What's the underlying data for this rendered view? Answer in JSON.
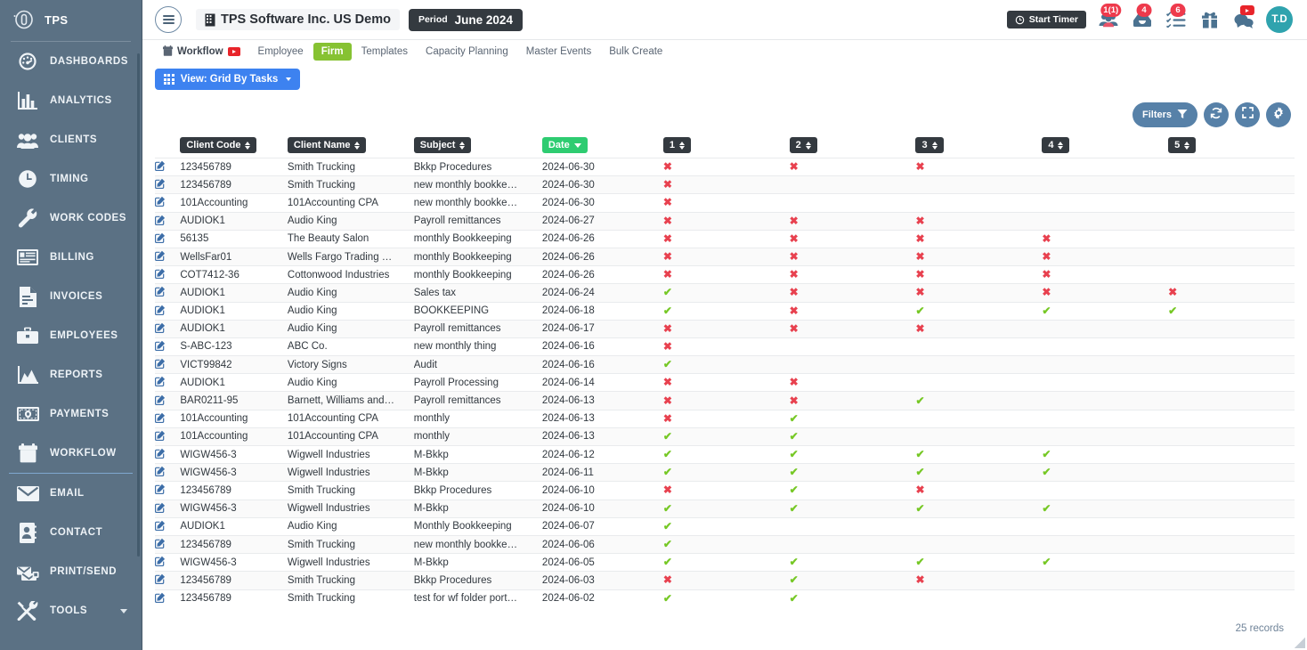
{
  "sidebar": {
    "brand": {
      "name": "TPS",
      "logo_icon": "tps-logo-icon"
    },
    "items": [
      {
        "label": "DASHBOARDS",
        "icon": "gauge-icon"
      },
      {
        "label": "ANALYTICS",
        "icon": "bar-chart-icon"
      },
      {
        "label": "CLIENTS",
        "icon": "people-icon"
      },
      {
        "label": "TIMING",
        "icon": "clock-icon"
      },
      {
        "label": "WORK CODES",
        "icon": "wrench-icon"
      },
      {
        "label": "BILLING",
        "icon": "billing-card-icon"
      },
      {
        "label": "INVOICES",
        "icon": "document-icon"
      },
      {
        "label": "EMPLOYEES",
        "icon": "briefcase-icon"
      },
      {
        "label": "REPORTS",
        "icon": "area-chart-icon"
      },
      {
        "label": "PAYMENTS",
        "icon": "banknote-icon"
      },
      {
        "label": "WORKFLOW",
        "icon": "calendar-icon"
      },
      {
        "label": "EMAIL",
        "icon": "envelope-icon"
      },
      {
        "label": "CONTACT",
        "icon": "address-book-icon"
      },
      {
        "label": "PRINT/SEND",
        "icon": "print-send-icon"
      },
      {
        "label": "TOOLS",
        "icon": "tools-icon",
        "caret": true
      }
    ]
  },
  "topbar": {
    "menu_icon": "hamburger-icon",
    "firm_icon": "building-icon",
    "firm_title": "TPS Software Inc. US Demo",
    "period_label": "Period",
    "period_value": "June 2024",
    "start_timer": "Start Timer",
    "icons": [
      {
        "name": "clients-group-icon",
        "badge": "1(1)"
      },
      {
        "name": "inbox-icon",
        "badge": "4"
      },
      {
        "name": "tasklist-icon",
        "badge": "6"
      },
      {
        "name": "gift-icon",
        "badge": ""
      },
      {
        "name": "chat-icon",
        "badge": "youtube"
      }
    ],
    "avatar": "T.D"
  },
  "subnav": {
    "tabs": [
      {
        "label": "Workflow",
        "active": false,
        "first": true,
        "youtube": true
      },
      {
        "label": "Employee",
        "active": false
      },
      {
        "label": "Firm",
        "active": true
      },
      {
        "label": "Templates",
        "active": false
      },
      {
        "label": "Capacity Planning",
        "active": false
      },
      {
        "label": "Master Events",
        "active": false
      },
      {
        "label": "Bulk Create",
        "active": false
      }
    ],
    "view_button": "View: Grid By Tasks"
  },
  "toolbar": {
    "filters_label": "Filters",
    "filter_icon": "funnel-icon",
    "refresh_icon": "refresh-icon",
    "expand_icon": "fullscreen-icon",
    "settings_icon": "gear-icon"
  },
  "table": {
    "columns": [
      {
        "key": "code",
        "label": "Client Code",
        "sort": "both"
      },
      {
        "key": "name",
        "label": "Client Name",
        "sort": "both"
      },
      {
        "key": "subject",
        "label": "Subject",
        "sort": "both"
      },
      {
        "key": "date",
        "label": "Date",
        "sort": "desc",
        "active": true
      },
      {
        "key": "s1",
        "label": "1",
        "sort": "both"
      },
      {
        "key": "s2",
        "label": "2",
        "sort": "both"
      },
      {
        "key": "s3",
        "label": "3",
        "sort": "both"
      },
      {
        "key": "s4",
        "label": "4",
        "sort": "both"
      },
      {
        "key": "s5",
        "label": "5",
        "sort": "both"
      }
    ],
    "edit_icon": "edit-pencil-icon",
    "mark_x": "✖",
    "mark_check": "✔",
    "colors": {
      "mark_x": "#e8414f",
      "mark_check": "#76c825",
      "accent_blue": "#3d82f0",
      "accent_green": "#86c232"
    },
    "rows": [
      {
        "code": "123456789",
        "name": "Smith Trucking",
        "subject": "Bkkp Procedures",
        "date": "2024-06-30",
        "marks": [
          "x",
          "x",
          "x",
          "",
          ""
        ]
      },
      {
        "code": "123456789",
        "name": "Smith Trucking",
        "subject": "new monthly bookke…",
        "date": "2024-06-30",
        "marks": [
          "x",
          "",
          "",
          "",
          ""
        ]
      },
      {
        "code": "101Accounting",
        "name": "101Accounting CPA",
        "subject": "new monthly bookke…",
        "date": "2024-06-30",
        "marks": [
          "x",
          "",
          "",
          "",
          ""
        ]
      },
      {
        "code": "AUDIOK1",
        "name": "Audio King",
        "subject": "Payroll remittances",
        "date": "2024-06-27",
        "marks": [
          "x",
          "x",
          "x",
          "",
          ""
        ]
      },
      {
        "code": "56135",
        "name": "The Beauty Salon",
        "subject": "monthly Bookkeeping",
        "date": "2024-06-26",
        "marks": [
          "x",
          "x",
          "x",
          "x",
          ""
        ]
      },
      {
        "code": "WellsFar01",
        "name": "Wells Fargo Trading …",
        "subject": "monthly Bookkeeping",
        "date": "2024-06-26",
        "marks": [
          "x",
          "x",
          "x",
          "x",
          ""
        ]
      },
      {
        "code": "COT7412-36",
        "name": "Cottonwood Industries",
        "subject": "monthly Bookkeeping",
        "date": "2024-06-26",
        "marks": [
          "x",
          "x",
          "x",
          "x",
          ""
        ]
      },
      {
        "code": "AUDIOK1",
        "name": "Audio King",
        "subject": "Sales tax",
        "date": "2024-06-24",
        "marks": [
          "v",
          "x",
          "x",
          "x",
          "x"
        ]
      },
      {
        "code": "AUDIOK1",
        "name": "Audio King",
        "subject": "BOOKKEEPING",
        "date": "2024-06-18",
        "marks": [
          "v",
          "x",
          "v",
          "v",
          "v"
        ]
      },
      {
        "code": "AUDIOK1",
        "name": "Audio King",
        "subject": "Payroll remittances",
        "date": "2024-06-17",
        "marks": [
          "x",
          "x",
          "x",
          "",
          ""
        ]
      },
      {
        "code": "S-ABC-123",
        "name": "ABC Co.",
        "subject": "new monthly thing",
        "date": "2024-06-16",
        "marks": [
          "x",
          "",
          "",
          "",
          ""
        ]
      },
      {
        "code": "VICT99842",
        "name": "Victory Signs",
        "subject": "Audit",
        "date": "2024-06-16",
        "marks": [
          "v",
          "",
          "",
          "",
          ""
        ]
      },
      {
        "code": "AUDIOK1",
        "name": "Audio King",
        "subject": "Payroll Processing",
        "date": "2024-06-14",
        "marks": [
          "x",
          "x",
          "",
          "",
          ""
        ]
      },
      {
        "code": "BAR0211-95",
        "name": "Barnett, Williams and…",
        "subject": "Payroll remittances",
        "date": "2024-06-13",
        "marks": [
          "x",
          "x",
          "v",
          "",
          ""
        ]
      },
      {
        "code": "101Accounting",
        "name": "101Accounting CPA",
        "subject": "monthly",
        "date": "2024-06-13",
        "marks": [
          "x",
          "v",
          "",
          "",
          ""
        ]
      },
      {
        "code": "101Accounting",
        "name": "101Accounting CPA",
        "subject": "monthly",
        "date": "2024-06-13",
        "marks": [
          "v",
          "v",
          "",
          "",
          ""
        ]
      },
      {
        "code": "WIGW456-3",
        "name": "Wigwell Industries",
        "subject": "M-Bkkp",
        "date": "2024-06-12",
        "marks": [
          "v",
          "v",
          "v",
          "v",
          ""
        ]
      },
      {
        "code": "WIGW456-3",
        "name": "Wigwell Industries",
        "subject": "M-Bkkp",
        "date": "2024-06-11",
        "marks": [
          "v",
          "v",
          "v",
          "v",
          ""
        ]
      },
      {
        "code": "123456789",
        "name": "Smith Trucking",
        "subject": "Bkkp Procedures",
        "date": "2024-06-10",
        "marks": [
          "x",
          "v",
          "x",
          "",
          ""
        ]
      },
      {
        "code": "WIGW456-3",
        "name": "Wigwell Industries",
        "subject": "M-Bkkp",
        "date": "2024-06-10",
        "marks": [
          "v",
          "v",
          "v",
          "v",
          ""
        ]
      },
      {
        "code": "AUDIOK1",
        "name": "Audio King",
        "subject": "Monthly Bookkeeping",
        "date": "2024-06-07",
        "marks": [
          "v",
          "",
          "",
          "",
          ""
        ]
      },
      {
        "code": "123456789",
        "name": "Smith Trucking",
        "subject": "new monthly bookke…",
        "date": "2024-06-06",
        "marks": [
          "v",
          "",
          "",
          "",
          ""
        ]
      },
      {
        "code": "WIGW456-3",
        "name": "Wigwell Industries",
        "subject": "M-Bkkp",
        "date": "2024-06-05",
        "marks": [
          "v",
          "v",
          "v",
          "v",
          ""
        ]
      },
      {
        "code": "123456789",
        "name": "Smith Trucking",
        "subject": "Bkkp Procedures",
        "date": "2024-06-03",
        "marks": [
          "x",
          "v",
          "x",
          "",
          ""
        ]
      },
      {
        "code": "123456789",
        "name": "Smith Trucking",
        "subject": "test for wf folder port…",
        "date": "2024-06-02",
        "marks": [
          "v",
          "v",
          "",
          "",
          ""
        ]
      }
    ],
    "record_count": "25 records"
  }
}
